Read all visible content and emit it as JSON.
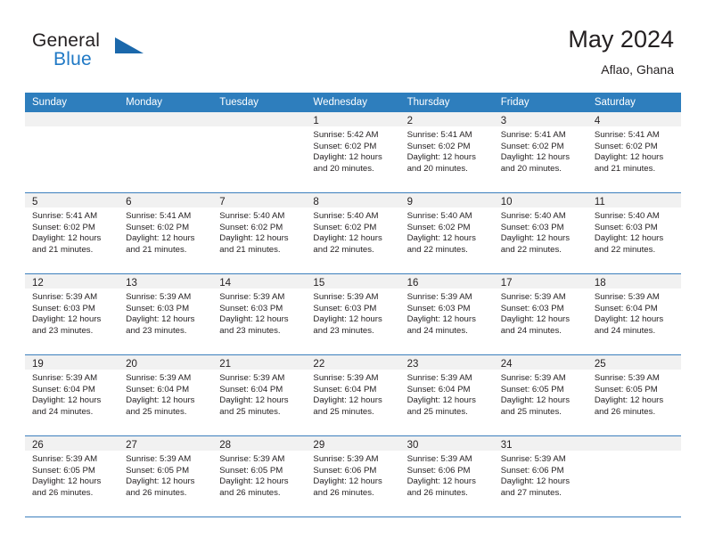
{
  "brand": {
    "name_part1": "General",
    "name_part2": "Blue",
    "logo_icon": "triangle-logo-icon"
  },
  "header": {
    "title": "May 2024",
    "subtitle": "Aflao, Ghana"
  },
  "colors": {
    "header_blue": "#2e7ebd",
    "brand_blue": "#2079c5",
    "day_band_gray": "#f1f1f1",
    "row_divider": "#3c7fbd",
    "text": "#231f20"
  },
  "weekdays": [
    "Sunday",
    "Monday",
    "Tuesday",
    "Wednesday",
    "Thursday",
    "Friday",
    "Saturday"
  ],
  "weeks": [
    [
      {
        "day": "",
        "empty": true
      },
      {
        "day": "",
        "empty": true
      },
      {
        "day": "",
        "empty": true
      },
      {
        "day": "1",
        "sunrise": "Sunrise: 5:42 AM",
        "sunset": "Sunset: 6:02 PM",
        "daylight1": "Daylight: 12 hours",
        "daylight2": "and 20 minutes."
      },
      {
        "day": "2",
        "sunrise": "Sunrise: 5:41 AM",
        "sunset": "Sunset: 6:02 PM",
        "daylight1": "Daylight: 12 hours",
        "daylight2": "and 20 minutes."
      },
      {
        "day": "3",
        "sunrise": "Sunrise: 5:41 AM",
        "sunset": "Sunset: 6:02 PM",
        "daylight1": "Daylight: 12 hours",
        "daylight2": "and 20 minutes."
      },
      {
        "day": "4",
        "sunrise": "Sunrise: 5:41 AM",
        "sunset": "Sunset: 6:02 PM",
        "daylight1": "Daylight: 12 hours",
        "daylight2": "and 21 minutes."
      }
    ],
    [
      {
        "day": "5",
        "sunrise": "Sunrise: 5:41 AM",
        "sunset": "Sunset: 6:02 PM",
        "daylight1": "Daylight: 12 hours",
        "daylight2": "and 21 minutes."
      },
      {
        "day": "6",
        "sunrise": "Sunrise: 5:41 AM",
        "sunset": "Sunset: 6:02 PM",
        "daylight1": "Daylight: 12 hours",
        "daylight2": "and 21 minutes."
      },
      {
        "day": "7",
        "sunrise": "Sunrise: 5:40 AM",
        "sunset": "Sunset: 6:02 PM",
        "daylight1": "Daylight: 12 hours",
        "daylight2": "and 21 minutes."
      },
      {
        "day": "8",
        "sunrise": "Sunrise: 5:40 AM",
        "sunset": "Sunset: 6:02 PM",
        "daylight1": "Daylight: 12 hours",
        "daylight2": "and 22 minutes."
      },
      {
        "day": "9",
        "sunrise": "Sunrise: 5:40 AM",
        "sunset": "Sunset: 6:02 PM",
        "daylight1": "Daylight: 12 hours",
        "daylight2": "and 22 minutes."
      },
      {
        "day": "10",
        "sunrise": "Sunrise: 5:40 AM",
        "sunset": "Sunset: 6:03 PM",
        "daylight1": "Daylight: 12 hours",
        "daylight2": "and 22 minutes."
      },
      {
        "day": "11",
        "sunrise": "Sunrise: 5:40 AM",
        "sunset": "Sunset: 6:03 PM",
        "daylight1": "Daylight: 12 hours",
        "daylight2": "and 22 minutes."
      }
    ],
    [
      {
        "day": "12",
        "sunrise": "Sunrise: 5:39 AM",
        "sunset": "Sunset: 6:03 PM",
        "daylight1": "Daylight: 12 hours",
        "daylight2": "and 23 minutes."
      },
      {
        "day": "13",
        "sunrise": "Sunrise: 5:39 AM",
        "sunset": "Sunset: 6:03 PM",
        "daylight1": "Daylight: 12 hours",
        "daylight2": "and 23 minutes."
      },
      {
        "day": "14",
        "sunrise": "Sunrise: 5:39 AM",
        "sunset": "Sunset: 6:03 PM",
        "daylight1": "Daylight: 12 hours",
        "daylight2": "and 23 minutes."
      },
      {
        "day": "15",
        "sunrise": "Sunrise: 5:39 AM",
        "sunset": "Sunset: 6:03 PM",
        "daylight1": "Daylight: 12 hours",
        "daylight2": "and 23 minutes."
      },
      {
        "day": "16",
        "sunrise": "Sunrise: 5:39 AM",
        "sunset": "Sunset: 6:03 PM",
        "daylight1": "Daylight: 12 hours",
        "daylight2": "and 24 minutes."
      },
      {
        "day": "17",
        "sunrise": "Sunrise: 5:39 AM",
        "sunset": "Sunset: 6:03 PM",
        "daylight1": "Daylight: 12 hours",
        "daylight2": "and 24 minutes."
      },
      {
        "day": "18",
        "sunrise": "Sunrise: 5:39 AM",
        "sunset": "Sunset: 6:04 PM",
        "daylight1": "Daylight: 12 hours",
        "daylight2": "and 24 minutes."
      }
    ],
    [
      {
        "day": "19",
        "sunrise": "Sunrise: 5:39 AM",
        "sunset": "Sunset: 6:04 PM",
        "daylight1": "Daylight: 12 hours",
        "daylight2": "and 24 minutes."
      },
      {
        "day": "20",
        "sunrise": "Sunrise: 5:39 AM",
        "sunset": "Sunset: 6:04 PM",
        "daylight1": "Daylight: 12 hours",
        "daylight2": "and 25 minutes."
      },
      {
        "day": "21",
        "sunrise": "Sunrise: 5:39 AM",
        "sunset": "Sunset: 6:04 PM",
        "daylight1": "Daylight: 12 hours",
        "daylight2": "and 25 minutes."
      },
      {
        "day": "22",
        "sunrise": "Sunrise: 5:39 AM",
        "sunset": "Sunset: 6:04 PM",
        "daylight1": "Daylight: 12 hours",
        "daylight2": "and 25 minutes."
      },
      {
        "day": "23",
        "sunrise": "Sunrise: 5:39 AM",
        "sunset": "Sunset: 6:04 PM",
        "daylight1": "Daylight: 12 hours",
        "daylight2": "and 25 minutes."
      },
      {
        "day": "24",
        "sunrise": "Sunrise: 5:39 AM",
        "sunset": "Sunset: 6:05 PM",
        "daylight1": "Daylight: 12 hours",
        "daylight2": "and 25 minutes."
      },
      {
        "day": "25",
        "sunrise": "Sunrise: 5:39 AM",
        "sunset": "Sunset: 6:05 PM",
        "daylight1": "Daylight: 12 hours",
        "daylight2": "and 26 minutes."
      }
    ],
    [
      {
        "day": "26",
        "sunrise": "Sunrise: 5:39 AM",
        "sunset": "Sunset: 6:05 PM",
        "daylight1": "Daylight: 12 hours",
        "daylight2": "and 26 minutes."
      },
      {
        "day": "27",
        "sunrise": "Sunrise: 5:39 AM",
        "sunset": "Sunset: 6:05 PM",
        "daylight1": "Daylight: 12 hours",
        "daylight2": "and 26 minutes."
      },
      {
        "day": "28",
        "sunrise": "Sunrise: 5:39 AM",
        "sunset": "Sunset: 6:05 PM",
        "daylight1": "Daylight: 12 hours",
        "daylight2": "and 26 minutes."
      },
      {
        "day": "29",
        "sunrise": "Sunrise: 5:39 AM",
        "sunset": "Sunset: 6:06 PM",
        "daylight1": "Daylight: 12 hours",
        "daylight2": "and 26 minutes."
      },
      {
        "day": "30",
        "sunrise": "Sunrise: 5:39 AM",
        "sunset": "Sunset: 6:06 PM",
        "daylight1": "Daylight: 12 hours",
        "daylight2": "and 26 minutes."
      },
      {
        "day": "31",
        "sunrise": "Sunrise: 5:39 AM",
        "sunset": "Sunset: 6:06 PM",
        "daylight1": "Daylight: 12 hours",
        "daylight2": "and 27 minutes."
      },
      {
        "day": "",
        "empty": true
      }
    ]
  ]
}
